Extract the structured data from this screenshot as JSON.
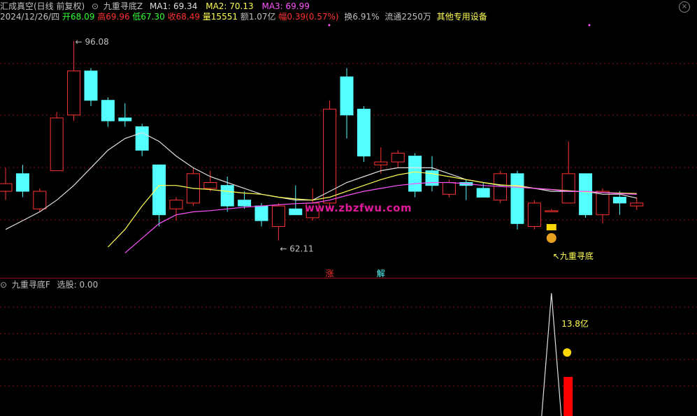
{
  "header": {
    "title": "汇成真空(日线 前复权)",
    "indicator_name": "九重寻底Z",
    "ma1_label": "MA1: 69.34",
    "ma2_label": "MA2: 70.13",
    "ma3_label": "MA3: 69.99"
  },
  "info": {
    "date": "2024/12/26/四",
    "open": "开68.09",
    "high": "高69.96",
    "low": "低67.30",
    "close": "收68.49",
    "volume": "量15551",
    "amount": "额1.07亿",
    "change": "幅0.39(0.57%)",
    "turnover": "换6.91%",
    "float": "流通2250万",
    "other": "其他专用设备"
  },
  "lower_panel": {
    "title": "九重寻底F",
    "value_label": "选股: 0.00",
    "pct_label": "13.8亿"
  },
  "watermark": "www.zbzfwu.com",
  "colors": {
    "up": "#ff3232",
    "down": "#54ffff",
    "ma1": "#e0e0e0",
    "ma2": "#ffff54",
    "ma3": "#ff54ff",
    "grid": "#8a1010",
    "text": "#c0c0c0"
  },
  "chart_data": {
    "type": "candlestick",
    "price_labels": {
      "high_label": "96.08",
      "low_label": "62.11"
    },
    "candles": [
      {
        "o": 70.5,
        "h": 74.5,
        "l": 69.0,
        "c": 71.8
      },
      {
        "o": 73.5,
        "h": 75.0,
        "l": 69.5,
        "c": 70.5
      },
      {
        "o": 67.5,
        "h": 71.0,
        "l": 67.0,
        "c": 70.5
      },
      {
        "o": 74.0,
        "h": 84.0,
        "l": 74.0,
        "c": 83.0
      },
      {
        "o": 83.5,
        "h": 96.08,
        "l": 82.5,
        "c": 91.0
      },
      {
        "o": 91.0,
        "h": 91.5,
        "l": 85.0,
        "c": 86.0
      },
      {
        "o": 86.0,
        "h": 86.5,
        "l": 81.5,
        "c": 82.5
      },
      {
        "o": 83.0,
        "h": 85.5,
        "l": 81.5,
        "c": 82.5
      },
      {
        "o": 81.5,
        "h": 82.0,
        "l": 76.5,
        "c": 77.5
      },
      {
        "o": 75.0,
        "h": 75.0,
        "l": 64.5,
        "c": 66.5
      },
      {
        "o": 67.5,
        "h": 69.5,
        "l": 65.5,
        "c": 69.0
      },
      {
        "o": 68.5,
        "h": 74.5,
        "l": 68.0,
        "c": 73.5
      },
      {
        "o": 71.0,
        "h": 74.0,
        "l": 70.5,
        "c": 72.0
      },
      {
        "o": 71.5,
        "h": 73.0,
        "l": 67.0,
        "c": 68.0
      },
      {
        "o": 69.0,
        "h": 70.5,
        "l": 67.5,
        "c": 68.0
      },
      {
        "o": 68.0,
        "h": 68.5,
        "l": 64.5,
        "c": 65.5
      },
      {
        "o": 64.5,
        "h": 68.5,
        "l": 62.11,
        "c": 68.0
      },
      {
        "o": 67.5,
        "h": 71.5,
        "l": 66.5,
        "c": 66.5
      },
      {
        "o": 66.0,
        "h": 71.0,
        "l": 65.5,
        "c": 68.5
      },
      {
        "o": 68.5,
        "h": 86.0,
        "l": 67.5,
        "c": 84.5
      },
      {
        "o": 90.0,
        "h": 91.5,
        "l": 79.5,
        "c": 83.5
      },
      {
        "o": 84.5,
        "h": 85.0,
        "l": 75.5,
        "c": 76.5
      },
      {
        "o": 75.0,
        "h": 78.0,
        "l": 73.5,
        "c": 75.5
      },
      {
        "o": 75.5,
        "h": 77.5,
        "l": 74.5,
        "c": 77.0
      },
      {
        "o": 76.5,
        "h": 77.0,
        "l": 69.5,
        "c": 70.5
      },
      {
        "o": 74.0,
        "h": 76.5,
        "l": 70.5,
        "c": 71.5
      },
      {
        "o": 70.0,
        "h": 72.5,
        "l": 69.5,
        "c": 72.0
      },
      {
        "o": 72.0,
        "h": 72.5,
        "l": 69.0,
        "c": 71.5
      },
      {
        "o": 71.0,
        "h": 72.0,
        "l": 69.5,
        "c": 69.5
      },
      {
        "o": 69.0,
        "h": 74.0,
        "l": 68.5,
        "c": 73.5
      },
      {
        "o": 73.5,
        "h": 74.0,
        "l": 64.0,
        "c": 65.0
      },
      {
        "o": 64.5,
        "h": 69.0,
        "l": 64.0,
        "c": 68.5
      },
      {
        "o": 67.0,
        "h": 67.5,
        "l": 67.0,
        "c": 67.2
      },
      {
        "o": 68.5,
        "h": 79.0,
        "l": 68.5,
        "c": 73.5
      },
      {
        "o": 73.5,
        "h": 73.5,
        "l": 66.0,
        "c": 66.5
      },
      {
        "o": 66.5,
        "h": 71.0,
        "l": 65.0,
        "c": 70.5
      },
      {
        "o": 69.5,
        "h": 70.5,
        "l": 66.5,
        "c": 68.5
      },
      {
        "o": 68.0,
        "h": 69.5,
        "l": 67.3,
        "c": 68.5
      }
    ],
    "ma1": [
      64.0,
      65.5,
      67.0,
      69.0,
      71.5,
      74.5,
      77.5,
      79.5,
      80.5,
      79.0,
      76.5,
      74.5,
      73.0,
      72.0,
      71.0,
      70.0,
      69.5,
      69.0,
      69.0,
      70.5,
      72.0,
      73.0,
      74.0,
      74.5,
      74.5,
      74.5,
      73.5,
      72.5,
      72.0,
      71.5,
      71.5,
      71.0,
      70.5,
      70.5,
      70.5,
      70.0,
      70.0,
      69.34
    ],
    "ma2": [
      null,
      null,
      null,
      null,
      null,
      null,
      61.0,
      64.0,
      68.0,
      71.5,
      71.5,
      71.0,
      70.8,
      70.5,
      70.2,
      70.0,
      69.5,
      69.2,
      69.0,
      69.5,
      70.5,
      71.5,
      72.5,
      73.3,
      73.8,
      73.5,
      73.0,
      72.5,
      72.0,
      71.6,
      71.4,
      71.0,
      70.8,
      70.6,
      70.4,
      70.3,
      70.2,
      70.13
    ],
    "ma3": [
      null,
      null,
      null,
      null,
      null,
      null,
      null,
      60.0,
      62.5,
      65.0,
      66.5,
      67.0,
      67.2,
      67.5,
      67.8,
      68.0,
      68.2,
      68.4,
      68.5,
      69.0,
      69.8,
      70.5,
      71.0,
      71.5,
      71.8,
      72.0,
      72.0,
      71.8,
      71.5,
      71.3,
      71.2,
      71.0,
      70.8,
      70.5,
      70.5,
      70.3,
      70.1,
      69.99
    ],
    "tags": [
      {
        "index": 19,
        "text": "涨",
        "color": "#ff3232"
      },
      {
        "index": 22,
        "text": "解",
        "color": "#54ffff"
      }
    ],
    "signal": {
      "index": 32,
      "text": "↖九重寻底"
    },
    "lower": {
      "spike_index": 32,
      "red_bar_index": 33
    }
  }
}
